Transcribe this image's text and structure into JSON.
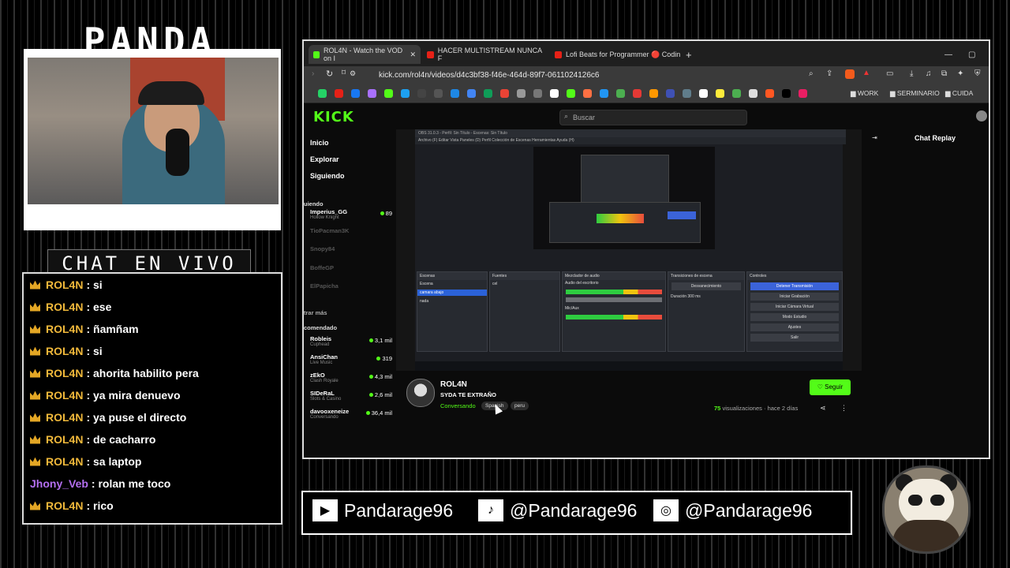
{
  "overlay": {
    "title": "PANDA",
    "chat_title": "CHAT EN VIVO",
    "chat": [
      {
        "user": "ROL4N",
        "msg": "si",
        "badge": true
      },
      {
        "user": "ROL4N",
        "msg": "ese",
        "badge": true
      },
      {
        "user": "ROL4N",
        "msg": "ñamñam",
        "badge": true
      },
      {
        "user": "ROL4N",
        "msg": "si",
        "badge": true
      },
      {
        "user": "ROL4N",
        "msg": "ahorita habilito pera",
        "badge": true
      },
      {
        "user": "ROL4N",
        "msg": "ya mira denuevo",
        "badge": true
      },
      {
        "user": "ROL4N",
        "msg": "ya puse el directo",
        "badge": true
      },
      {
        "user": "ROL4N",
        "msg": "de cacharro",
        "badge": true
      },
      {
        "user": "ROL4N",
        "msg": "sa laptop",
        "badge": true
      },
      {
        "user": "Jhony_Veb",
        "msg": "rolan me toco",
        "badge": false
      },
      {
        "user": "ROL4N",
        "msg": "rico",
        "badge": true
      }
    ],
    "social": [
      {
        "icon": "youtube-icon",
        "glyph": "▶",
        "text": "Pandarage96"
      },
      {
        "icon": "tiktok-icon",
        "glyph": "♪",
        "text": "@Pandarage96"
      },
      {
        "icon": "instagram-icon",
        "glyph": "◎",
        "text": "@Pandarage96"
      }
    ]
  },
  "browser": {
    "tabs": [
      {
        "label": "ROL4N - Watch the VOD on I",
        "fav": "#53fc18",
        "active": true
      },
      {
        "label": "HACER MULTISTREAM NUNCA F",
        "fav": "#e62117",
        "active": false
      },
      {
        "label": "Lofi Beats for Programmer 🔴 Codin",
        "fav": "#e62117",
        "active": false
      }
    ],
    "url": "kick.com/rol4n/videos/d4c3bf38-f46e-464d-89f7-0611024126c6",
    "bookmark_folders": [
      "WORK",
      "SERMINARIO",
      "CUIDA"
    ],
    "search_placeholder": "Buscar",
    "kick_logo": "KICK",
    "nav": [
      "Inicio",
      "Explorar",
      "Siguiendo"
    ],
    "following_header": "uiendo",
    "following": [
      {
        "name": "Imperius_GG",
        "game": "Hollow Knight",
        "viewers": "89",
        "live": true
      },
      {
        "name": "TioPacman3K",
        "game": "",
        "viewers": "",
        "live": false
      },
      {
        "name": "Snopy84",
        "game": "",
        "viewers": "",
        "live": false
      },
      {
        "name": "BoffeGP",
        "game": "",
        "viewers": "",
        "live": false
      },
      {
        "name": "ElPapicha",
        "game": "",
        "viewers": "",
        "live": false
      }
    ],
    "show_more": "trar más",
    "recommended_header": "comendado",
    "recommended": [
      {
        "name": "Robleis",
        "game": "Cuphead",
        "viewers": "3,1 mil"
      },
      {
        "name": "AnsiChan",
        "game": "Live Music",
        "viewers": "319"
      },
      {
        "name": "zEkO",
        "game": "Clash Royale",
        "viewers": "4,3 mil"
      },
      {
        "name": "SIDeRaL",
        "game": "Slots & Casino",
        "viewers": "2,6 mil"
      },
      {
        "name": "davooxeneize",
        "game": "Conversando",
        "viewers": "36,4 mil"
      }
    ],
    "obs_title": "OBS 31.0.3 - Perfil: Sin Título - Escenas: Sin Título",
    "obs_menu": "Archivo (F)   Editar   Vista   Paneles (D)   Perfil   Colección de Escenas   Herramientas   Ayuda (H)",
    "obs_docks": {
      "scenes": {
        "title": "Escenas",
        "items": [
          "Escena",
          "camara abajo",
          "nada"
        ],
        "selected": 1
      },
      "sources": {
        "title": "Fuentes",
        "items": [
          "cel"
        ]
      },
      "mixer": {
        "title": "Mezclador de audio",
        "items": [
          "Audio del escritorio",
          "Mic/Aux"
        ]
      },
      "transitions": {
        "title": "Transiciones de escena",
        "items": [
          "Desvanecimiento",
          "Duración  300 ms"
        ]
      },
      "controls": {
        "title": "Controles",
        "buttons": [
          "Detener Transmisión",
          "Iniciar Grabación",
          "Iniciar Cámara Virtual",
          "Modo Estudio",
          "Ajustes",
          "Salir"
        ]
      }
    },
    "chat_replay": "Chat Replay",
    "video": {
      "streamer": "ROL4N",
      "title": "SYDA TE EXTRAÑO",
      "category": "Conversando",
      "tags": [
        "Spanish",
        "peru"
      ],
      "follow": "Seguir",
      "views_count": "75",
      "views_label": "visualizaciones",
      "age": "hace 2 días"
    }
  }
}
